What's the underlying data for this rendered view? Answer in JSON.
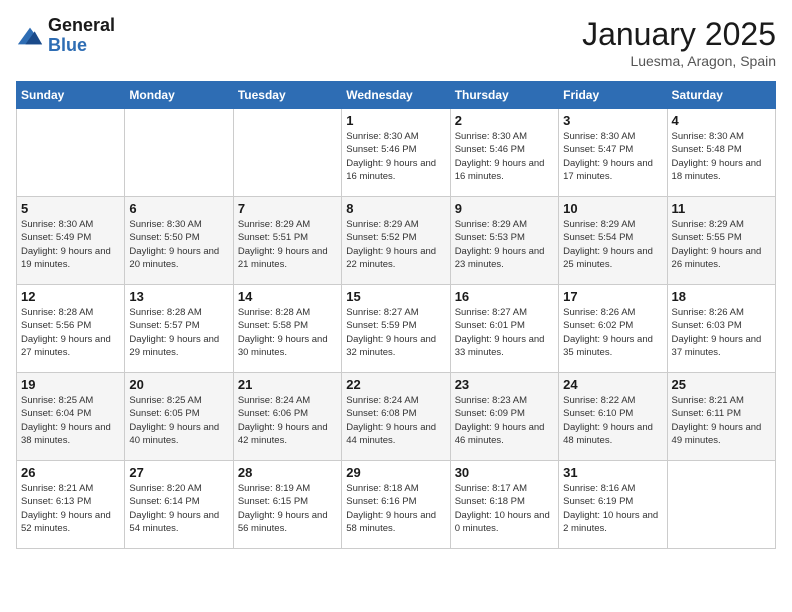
{
  "header": {
    "logo_general": "General",
    "logo_blue": "Blue",
    "month_title": "January 2025",
    "location": "Luesma, Aragon, Spain"
  },
  "days_of_week": [
    "Sunday",
    "Monday",
    "Tuesday",
    "Wednesday",
    "Thursday",
    "Friday",
    "Saturday"
  ],
  "weeks": [
    [
      {
        "day": "",
        "info": ""
      },
      {
        "day": "",
        "info": ""
      },
      {
        "day": "",
        "info": ""
      },
      {
        "day": "1",
        "info": "Sunrise: 8:30 AM\nSunset: 5:46 PM\nDaylight: 9 hours\nand 16 minutes."
      },
      {
        "day": "2",
        "info": "Sunrise: 8:30 AM\nSunset: 5:46 PM\nDaylight: 9 hours\nand 16 minutes."
      },
      {
        "day": "3",
        "info": "Sunrise: 8:30 AM\nSunset: 5:47 PM\nDaylight: 9 hours\nand 17 minutes."
      },
      {
        "day": "4",
        "info": "Sunrise: 8:30 AM\nSunset: 5:48 PM\nDaylight: 9 hours\nand 18 minutes."
      }
    ],
    [
      {
        "day": "5",
        "info": "Sunrise: 8:30 AM\nSunset: 5:49 PM\nDaylight: 9 hours\nand 19 minutes."
      },
      {
        "day": "6",
        "info": "Sunrise: 8:30 AM\nSunset: 5:50 PM\nDaylight: 9 hours\nand 20 minutes."
      },
      {
        "day": "7",
        "info": "Sunrise: 8:29 AM\nSunset: 5:51 PM\nDaylight: 9 hours\nand 21 minutes."
      },
      {
        "day": "8",
        "info": "Sunrise: 8:29 AM\nSunset: 5:52 PM\nDaylight: 9 hours\nand 22 minutes."
      },
      {
        "day": "9",
        "info": "Sunrise: 8:29 AM\nSunset: 5:53 PM\nDaylight: 9 hours\nand 23 minutes."
      },
      {
        "day": "10",
        "info": "Sunrise: 8:29 AM\nSunset: 5:54 PM\nDaylight: 9 hours\nand 25 minutes."
      },
      {
        "day": "11",
        "info": "Sunrise: 8:29 AM\nSunset: 5:55 PM\nDaylight: 9 hours\nand 26 minutes."
      }
    ],
    [
      {
        "day": "12",
        "info": "Sunrise: 8:28 AM\nSunset: 5:56 PM\nDaylight: 9 hours\nand 27 minutes."
      },
      {
        "day": "13",
        "info": "Sunrise: 8:28 AM\nSunset: 5:57 PM\nDaylight: 9 hours\nand 29 minutes."
      },
      {
        "day": "14",
        "info": "Sunrise: 8:28 AM\nSunset: 5:58 PM\nDaylight: 9 hours\nand 30 minutes."
      },
      {
        "day": "15",
        "info": "Sunrise: 8:27 AM\nSunset: 5:59 PM\nDaylight: 9 hours\nand 32 minutes."
      },
      {
        "day": "16",
        "info": "Sunrise: 8:27 AM\nSunset: 6:01 PM\nDaylight: 9 hours\nand 33 minutes."
      },
      {
        "day": "17",
        "info": "Sunrise: 8:26 AM\nSunset: 6:02 PM\nDaylight: 9 hours\nand 35 minutes."
      },
      {
        "day": "18",
        "info": "Sunrise: 8:26 AM\nSunset: 6:03 PM\nDaylight: 9 hours\nand 37 minutes."
      }
    ],
    [
      {
        "day": "19",
        "info": "Sunrise: 8:25 AM\nSunset: 6:04 PM\nDaylight: 9 hours\nand 38 minutes."
      },
      {
        "day": "20",
        "info": "Sunrise: 8:25 AM\nSunset: 6:05 PM\nDaylight: 9 hours\nand 40 minutes."
      },
      {
        "day": "21",
        "info": "Sunrise: 8:24 AM\nSunset: 6:06 PM\nDaylight: 9 hours\nand 42 minutes."
      },
      {
        "day": "22",
        "info": "Sunrise: 8:24 AM\nSunset: 6:08 PM\nDaylight: 9 hours\nand 44 minutes."
      },
      {
        "day": "23",
        "info": "Sunrise: 8:23 AM\nSunset: 6:09 PM\nDaylight: 9 hours\nand 46 minutes."
      },
      {
        "day": "24",
        "info": "Sunrise: 8:22 AM\nSunset: 6:10 PM\nDaylight: 9 hours\nand 48 minutes."
      },
      {
        "day": "25",
        "info": "Sunrise: 8:21 AM\nSunset: 6:11 PM\nDaylight: 9 hours\nand 49 minutes."
      }
    ],
    [
      {
        "day": "26",
        "info": "Sunrise: 8:21 AM\nSunset: 6:13 PM\nDaylight: 9 hours\nand 52 minutes."
      },
      {
        "day": "27",
        "info": "Sunrise: 8:20 AM\nSunset: 6:14 PM\nDaylight: 9 hours\nand 54 minutes."
      },
      {
        "day": "28",
        "info": "Sunrise: 8:19 AM\nSunset: 6:15 PM\nDaylight: 9 hours\nand 56 minutes."
      },
      {
        "day": "29",
        "info": "Sunrise: 8:18 AM\nSunset: 6:16 PM\nDaylight: 9 hours\nand 58 minutes."
      },
      {
        "day": "30",
        "info": "Sunrise: 8:17 AM\nSunset: 6:18 PM\nDaylight: 10 hours\nand 0 minutes."
      },
      {
        "day": "31",
        "info": "Sunrise: 8:16 AM\nSunset: 6:19 PM\nDaylight: 10 hours\nand 2 minutes."
      },
      {
        "day": "",
        "info": ""
      }
    ]
  ]
}
